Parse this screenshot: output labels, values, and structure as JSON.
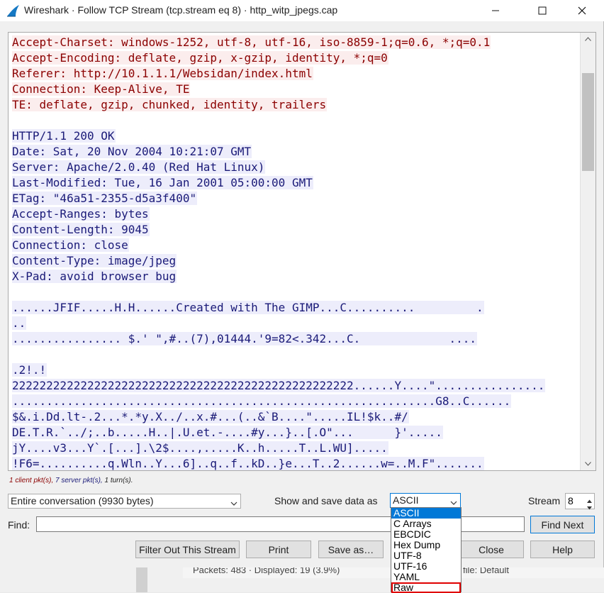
{
  "window": {
    "title": "Wireshark · Follow TCP Stream (tcp.stream eq 8) · http_witp_jpegs.cap"
  },
  "stream": {
    "lines": [
      {
        "text": "Accept-Charset: windows-1252, utf-8, utf-16, iso-8859-1;q=0.6, *;q=0.1",
        "dir": "client"
      },
      {
        "text": "Accept-Encoding: deflate, gzip, x-gzip, identity, *;q=0",
        "dir": "client"
      },
      {
        "text": "Referer: http://10.1.1.1/Websidan/index.html",
        "dir": "client"
      },
      {
        "text": "Connection: Keep-Alive, TE",
        "dir": "client"
      },
      {
        "text": "TE: deflate, gzip, chunked, identity, trailers",
        "dir": "client"
      },
      {
        "text": "",
        "dir": "none"
      },
      {
        "text": "HTTP/1.1 200 OK",
        "dir": "server"
      },
      {
        "text": "Date: Sat, 20 Nov 2004 10:21:07 GMT",
        "dir": "server"
      },
      {
        "text": "Server: Apache/2.0.40 (Red Hat Linux)",
        "dir": "server"
      },
      {
        "text": "Last-Modified: Tue, 16 Jan 2001 05:00:00 GMT",
        "dir": "server"
      },
      {
        "text": "ETag: \"46a51-2355-d5a3f400\"",
        "dir": "server"
      },
      {
        "text": "Accept-Ranges: bytes",
        "dir": "server"
      },
      {
        "text": "Content-Length: 9045",
        "dir": "server"
      },
      {
        "text": "Connection: close",
        "dir": "server"
      },
      {
        "text": "Content-Type: image/jpeg",
        "dir": "server"
      },
      {
        "text": "X-Pad: avoid browser bug",
        "dir": "server"
      },
      {
        "text": "",
        "dir": "none"
      },
      {
        "text": "......JFIF.....H.H......Created with The GIMP...C..........         .",
        "dir": "server"
      },
      {
        "text": "..",
        "dir": "server"
      },
      {
        "text": "................ $.' \",#..(7),01444.'9=82<.342...C.             ....",
        "dir": "server"
      },
      {
        "text": "",
        "dir": "none"
      },
      {
        "text": ".2!.!",
        "dir": "server"
      },
      {
        "text": "22222222222222222222222222222222222222222222222222......Y....\"................",
        "dir": "server"
      },
      {
        "text": "..............................................................G8..C......",
        "dir": "server"
      },
      {
        "text": "$&.i.Dd.lt-.2...*.*y.X../..x.#...(..&`B....\".....IL!$k..#/",
        "dir": "server"
      },
      {
        "text": "DE.T.R.`../;..b.....H..|.U.et.-....#y...}..[.O\"...      }'.....",
        "dir": "server"
      },
      {
        "text": "jY....v3...Y`.[...].\\2$....,.....K..h.....T..L.WU].....",
        "dir": "server"
      },
      {
        "text": "!F6=..........q.Wln..Y...6]..q..f..kD..}e...T..2......w=..M.F\".......",
        "dir": "server"
      }
    ]
  },
  "summary": {
    "client": "1 client pkt(s),",
    "server": "7 server pkt(s),",
    "turns": "1 turn(s)."
  },
  "controls": {
    "conversation": "Entire conversation (9930 bytes)",
    "show_save_label": "Show and save data as",
    "format_value": "ASCII",
    "format_options": [
      "ASCII",
      "C Arrays",
      "EBCDIC",
      "Hex Dump",
      "UTF-8",
      "UTF-16",
      "YAML",
      "Raw"
    ],
    "stream_label": "Stream",
    "stream_value": "8",
    "find_label": "Find:",
    "find_value": "",
    "find_next": "Find Next",
    "filter_out": "Filter Out This Stream",
    "print": "Print",
    "save_as": "Save as…",
    "close": "Close",
    "help": "Help"
  },
  "background": {
    "status": "Packets: 483 · Displayed: 19 (3.9%)",
    "profile": "file: Default"
  },
  "colors": {
    "client_text": "#8b0000",
    "server_text": "#1a1a78",
    "accent": "#0078d7",
    "highlight": "#e00000"
  }
}
